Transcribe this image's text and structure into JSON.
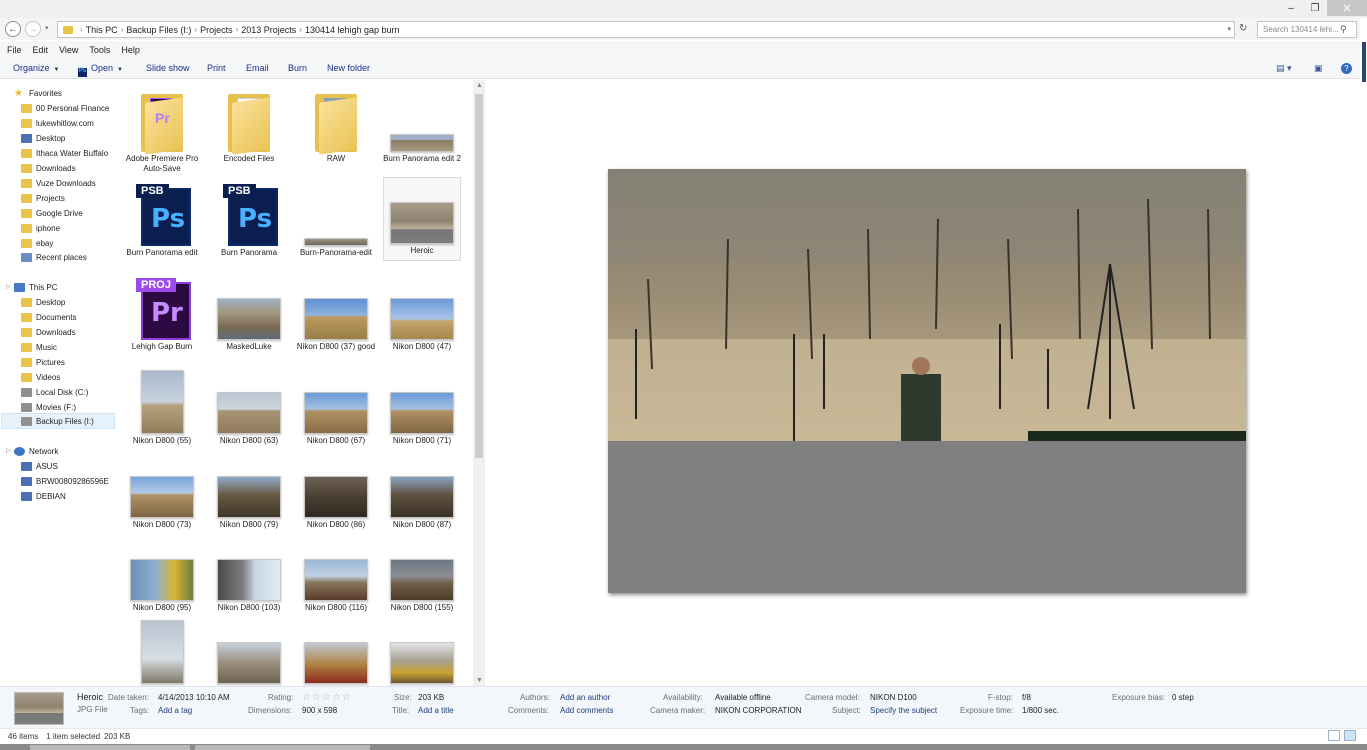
{
  "window": {
    "minimize": "–",
    "restore": "❐",
    "close": "✕"
  },
  "address": {
    "back_glyph": "←",
    "forward_glyph": "→",
    "crumbs": [
      "This PC",
      "Backup Files (I:)",
      "Projects",
      "2013 Projects",
      "130414 lehigh gap burn"
    ],
    "search_placeholder": "Search 130414 lehi...",
    "refresh_glyph": "↻"
  },
  "menu": [
    "File",
    "Edit",
    "View",
    "Tools",
    "Help"
  ],
  "toolbar": {
    "organize": "Organize",
    "open": "Open",
    "slideshow": "Slide show",
    "print": "Print",
    "email": "Email",
    "burn": "Burn",
    "new_folder": "New folder",
    "help_glyph": "?"
  },
  "navpane": {
    "favorites_header": "Favorites",
    "favorites": [
      "00 Personal Finance",
      "lukewhitlow.com",
      "Desktop",
      "Ithaca Water Buffalo",
      "Downloads",
      "Vuze Downloads",
      "Projects",
      "Google Drive",
      "iphone",
      "ebay",
      "Recent places"
    ],
    "thispc_header": "This PC",
    "thispc": [
      "Desktop",
      "Documents",
      "Downloads",
      "Music",
      "Pictures",
      "Videos",
      "Local Disk (C:)",
      "Movies (F:)",
      "Backup Files (I:)"
    ],
    "network_header": "Network",
    "network": [
      "ASUS",
      "BRW00809286596E",
      "DEBIAN"
    ]
  },
  "files": {
    "row1": [
      "Adobe Premiere Pro Auto-Save",
      "Encoded Files",
      "RAW",
      "Burn Panorama edit 2"
    ],
    "row2": [
      "Burn Panorama edit",
      "Burn Panorama",
      "Burn-Panorama-edit",
      "Heroic"
    ],
    "row3": [
      "Lehigh Gap Burn",
      "MaskedLuke",
      "Nikon D800 (37) good",
      "Nikon D800 (47)"
    ],
    "row4": [
      "Nikon D800 (55)",
      "Nikon D800 (63)",
      "Nikon D800 (67)",
      "Nikon D800 (71)"
    ],
    "row5": [
      "Nikon D800 (73)",
      "Nikon D800 (79)",
      "Nikon D800 (86)",
      "Nikon D800 (87)"
    ],
    "row6": [
      "Nikon D800 (95)",
      "Nikon D800 (103)",
      "Nikon D800 (116)",
      "Nikon D800 (155)"
    ],
    "icons": {
      "pr": "Pr",
      "ps": "Ps",
      "psb": "PSB",
      "proj": "PROJ"
    }
  },
  "details": {
    "name": "Heroic",
    "type": "JPG File",
    "date_taken_label": "Date taken:",
    "date_taken": "4/14/2013 10:10 AM",
    "tags_label": "Tags:",
    "tags": "Add a tag",
    "rating_label": "Rating:",
    "rating_stars": "☆☆☆☆☆",
    "rating": 0,
    "dimensions_label": "Dimensions:",
    "dimensions": "900 x 598",
    "size_label": "Size:",
    "size": "203 KB",
    "title_label": "Title:",
    "title": "Add a title",
    "authors_label": "Authors:",
    "authors": "Add an author",
    "comments_label": "Comments:",
    "comments": "Add comments",
    "availability_label": "Availability:",
    "availability": "Available offline",
    "camera_maker_label": "Camera maker:",
    "camera_maker": "NIKON CORPORATION",
    "camera_model_label": "Camera model:",
    "camera_model": "NIKON D100",
    "subject_label": "Subject:",
    "subject": "Specify the subject",
    "fstop_label": "F-stop:",
    "fstop": "f/8",
    "exposure_time_label": "Exposure time:",
    "exposure_time": "1/800 sec.",
    "exposure_bias_label": "Exposure bias:",
    "exposure_bias": "0 step"
  },
  "status": {
    "items": "46 items",
    "selected": "1 item selected",
    "size": "203 KB"
  }
}
